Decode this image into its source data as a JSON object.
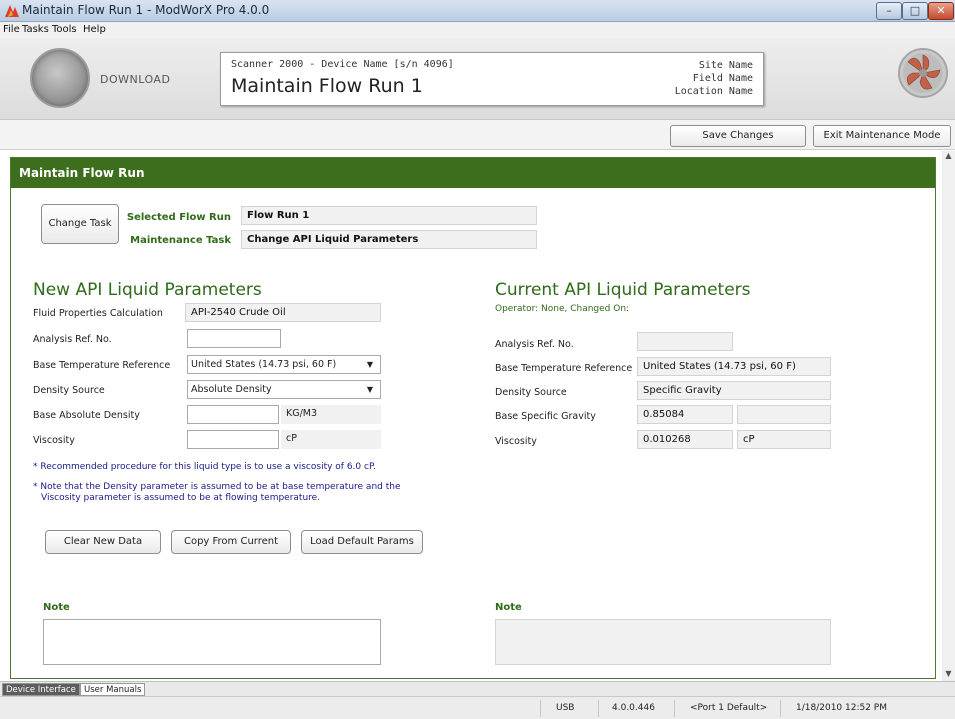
{
  "window": {
    "title": "Maintain Flow Run 1 - ModWorX Pro 4.0.0",
    "controls": {
      "minimize": "–",
      "maximize": "□",
      "close": "✕"
    }
  },
  "menu": [
    "File",
    "Tasks",
    "Tools",
    "Help"
  ],
  "header": {
    "download_label": "DOWNLOAD",
    "device_line": "Scanner 2000 - Device Name [s/n 4096]",
    "page_title": "Maintain Flow Run 1",
    "site_name": "Site Name",
    "field_name": "Field Name",
    "location_name": "Location Name"
  },
  "actions": {
    "save": "Save Changes",
    "exit": "Exit Maintenance Mode"
  },
  "panel": {
    "title": "Maintain Flow Run",
    "change_task": "Change Task",
    "selected_flow_run_label": "Selected Flow Run",
    "selected_flow_run_value": "Flow Run 1",
    "maintenance_task_label": "Maintenance Task",
    "maintenance_task_value": "Change API Liquid Parameters"
  },
  "new_params": {
    "title": "New API Liquid Parameters",
    "fluid_calc_label": "Fluid Properties Calculation",
    "fluid_calc_value": "API-2540 Crude Oil",
    "analysis_label": "Analysis Ref. No.",
    "analysis_value": "",
    "base_temp_label": "Base Temperature Reference",
    "base_temp_value": "United States (14.73 psi, 60 F)",
    "density_source_label": "Density Source",
    "density_source_value": "Absolute Density",
    "base_density_label": "Base Absolute Density",
    "base_density_value": "",
    "base_density_unit": "KG/M3",
    "viscosity_label": "Viscosity",
    "viscosity_value": "",
    "viscosity_unit": "cP",
    "note1": "* Recommended procedure for this liquid type is to use a viscosity of 6.0 cP.",
    "note2_line1": "* Note that the Density parameter is assumed to be at base temperature and the",
    "note2_line2": "Viscosity parameter is assumed to be at flowing temperature.",
    "btn_clear": "Clear New Data",
    "btn_copy": "Copy From Current",
    "btn_load": "Load Default Params",
    "note_label": "Note",
    "note_value": ""
  },
  "current_params": {
    "title": "Current API Liquid Parameters",
    "operator_line": "Operator: None, Changed On:",
    "analysis_label": "Analysis Ref. No.",
    "analysis_value": "",
    "base_temp_label": "Base Temperature Reference",
    "base_temp_value": "United States (14.73 psi, 60 F)",
    "density_source_label": "Density Source",
    "density_source_value": "Specific Gravity",
    "base_sg_label": "Base Specific Gravity",
    "base_sg_value": "0.85084",
    "base_sg_extra": "",
    "viscosity_label": "Viscosity",
    "viscosity_value": "0.010268",
    "viscosity_unit": "cP",
    "note_label": "Note",
    "note_value": ""
  },
  "bottom_tabs": [
    "Device Interface",
    "User Manuals"
  ],
  "status": {
    "connection": "USB",
    "version": "4.0.0.446",
    "port": "<Port 1 Default>",
    "datetime": "1/18/2010 12:52 PM"
  },
  "colors": {
    "panel_header": "#3c6e1e",
    "label_green": "#2f6b1a",
    "note_blue": "#1a1a8a"
  }
}
